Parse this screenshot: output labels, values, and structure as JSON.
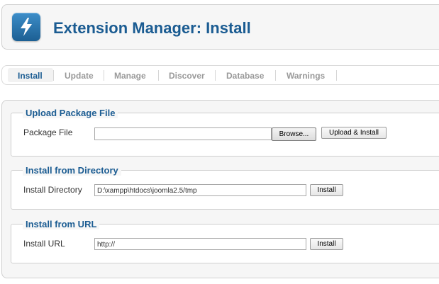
{
  "header": {
    "title": "Extension Manager: Install",
    "logo_icon": "lightning-bolt-icon"
  },
  "tabs": [
    {
      "label": "Install",
      "active": true
    },
    {
      "label": "Update",
      "active": false
    },
    {
      "label": "Manage",
      "active": false
    },
    {
      "label": "Discover",
      "active": false
    },
    {
      "label": "Database",
      "active": false
    },
    {
      "label": "Warnings",
      "active": false
    }
  ],
  "upload": {
    "legend": "Upload Package File",
    "label": "Package File",
    "value": "",
    "browse_label": "Browse...",
    "submit_label": "Upload & Install"
  },
  "directory": {
    "legend": "Install from Directory",
    "label": "Install Directory",
    "value": "D:\\xampp\\htdocs\\joomla2.5/tmp",
    "submit_label": "Install"
  },
  "url": {
    "legend": "Install from URL",
    "label": "Install URL",
    "value": "http://",
    "submit_label": "Install"
  },
  "colors": {
    "accent": "#1b5c92",
    "tab_inactive": "#999999"
  }
}
